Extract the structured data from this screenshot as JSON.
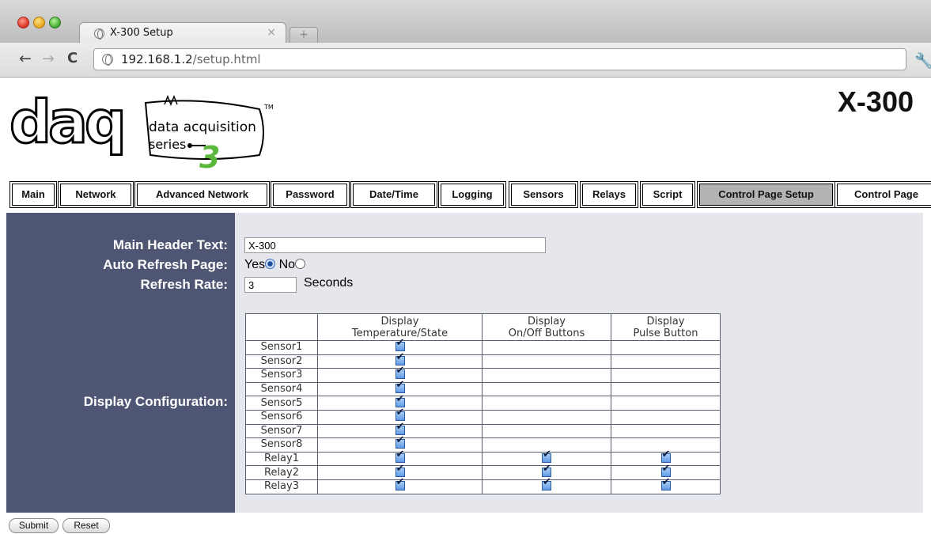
{
  "browser": {
    "tab_title": "X-300 Setup",
    "tab_close": "×",
    "new_tab": "+",
    "url_host": "192.168.1.2",
    "url_path": "/setup.html"
  },
  "header": {
    "logo_word": "daq",
    "logo_line1": "data acquisition",
    "logo_line2": "series",
    "logo_digit": "3",
    "logo_tm": "TM",
    "product_name": "X-300"
  },
  "nav": {
    "tabs": [
      {
        "label": "Main"
      },
      {
        "label": "Network"
      },
      {
        "label": "Advanced Network"
      },
      {
        "label": "Password"
      },
      {
        "label": "Date/Time"
      },
      {
        "label": "Logging"
      },
      {
        "label": "Sensors"
      },
      {
        "label": "Relays"
      },
      {
        "label": "Script"
      },
      {
        "label": "Control Page Setup",
        "active": true
      },
      {
        "label": "Control Page"
      }
    ]
  },
  "form": {
    "header_label": "Main Header Text:",
    "header_value": "X-300",
    "refresh_label": "Auto Refresh Page:",
    "refresh_yes": "Yes",
    "refresh_no": "No",
    "refresh_selected": "Yes",
    "rate_label": "Refresh Rate:",
    "rate_value": "3",
    "rate_unit": "Seconds",
    "display_label": "Display Configuration:"
  },
  "table": {
    "headers": [
      "",
      "Display\nTemperature/State",
      "Display\nOn/Off Buttons",
      "Display\nPulse Button"
    ],
    "rows": [
      {
        "name": "Sensor1",
        "temp": true,
        "onoff": false,
        "pulse": false
      },
      {
        "name": "Sensor2",
        "temp": true,
        "onoff": false,
        "pulse": false
      },
      {
        "name": "Sensor3",
        "temp": true,
        "onoff": false,
        "pulse": false
      },
      {
        "name": "Sensor4",
        "temp": true,
        "onoff": false,
        "pulse": false
      },
      {
        "name": "Sensor5",
        "temp": true,
        "onoff": false,
        "pulse": false
      },
      {
        "name": "Sensor6",
        "temp": true,
        "onoff": false,
        "pulse": false
      },
      {
        "name": "Sensor7",
        "temp": true,
        "onoff": false,
        "pulse": false
      },
      {
        "name": "Sensor8",
        "temp": true,
        "onoff": false,
        "pulse": false
      },
      {
        "name": "Relay1",
        "temp": true,
        "onoff": true,
        "pulse": true
      },
      {
        "name": "Relay2",
        "temp": true,
        "onoff": true,
        "pulse": true
      },
      {
        "name": "Relay3",
        "temp": true,
        "onoff": true,
        "pulse": true
      }
    ]
  },
  "buttons": {
    "submit": "Submit",
    "reset": "Reset"
  },
  "colors": {
    "label_panel": "#4f5673",
    "field_panel": "#e6e7ec",
    "active_tab": "#b3b3b3",
    "logo_green": "#5cb83c"
  }
}
